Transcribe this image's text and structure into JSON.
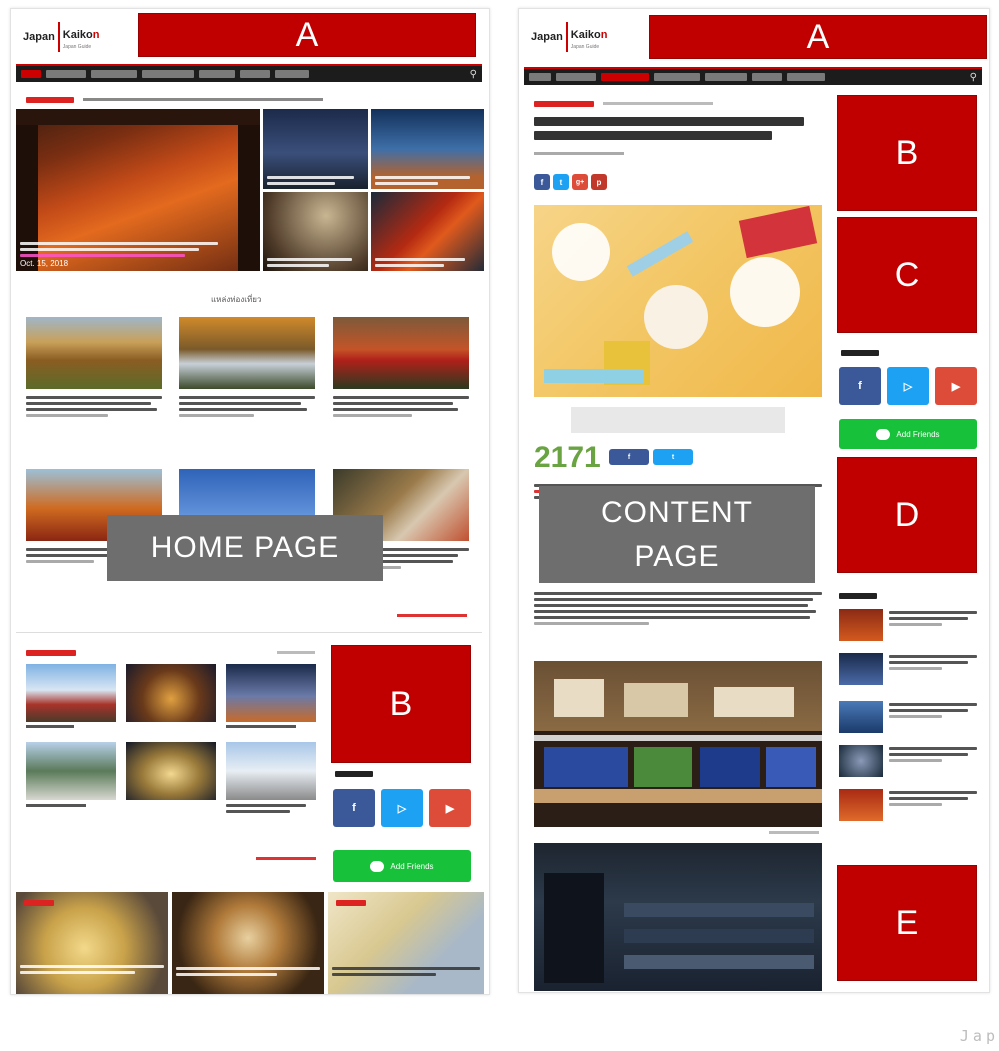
{
  "home": {
    "logo": {
      "word1": "Japan",
      "word2a": "Kaiko",
      "word2b": "n",
      "tag": "Japan Guide"
    },
    "banner_label": "A",
    "overlay_label": "HOME PAGE",
    "sidebar_ad_label": "B",
    "line_button": "Add Friends",
    "hero_date": "Oct. 15, 2018",
    "section_title": "แหล่งท่องเที่ยว"
  },
  "content": {
    "logo": {
      "word1": "Japan",
      "word2a": "Kaiko",
      "word2b": "n",
      "tag": "Japan Guide"
    },
    "banner_label": "A",
    "overlay_line1": "CONTENT",
    "overlay_line2": "PAGE",
    "ad_labels": [
      "B",
      "C",
      "D",
      "E"
    ],
    "share_count": "2171",
    "line_button": "Add Friends"
  },
  "watermark": "Jap",
  "colors": {
    "brand_red": "#c00000",
    "nav_dark": "#1c1c1c",
    "facebook": "#3b5998",
    "twitter": "#1da1f2",
    "google": "#dd4b39",
    "line": "#17c13a"
  }
}
